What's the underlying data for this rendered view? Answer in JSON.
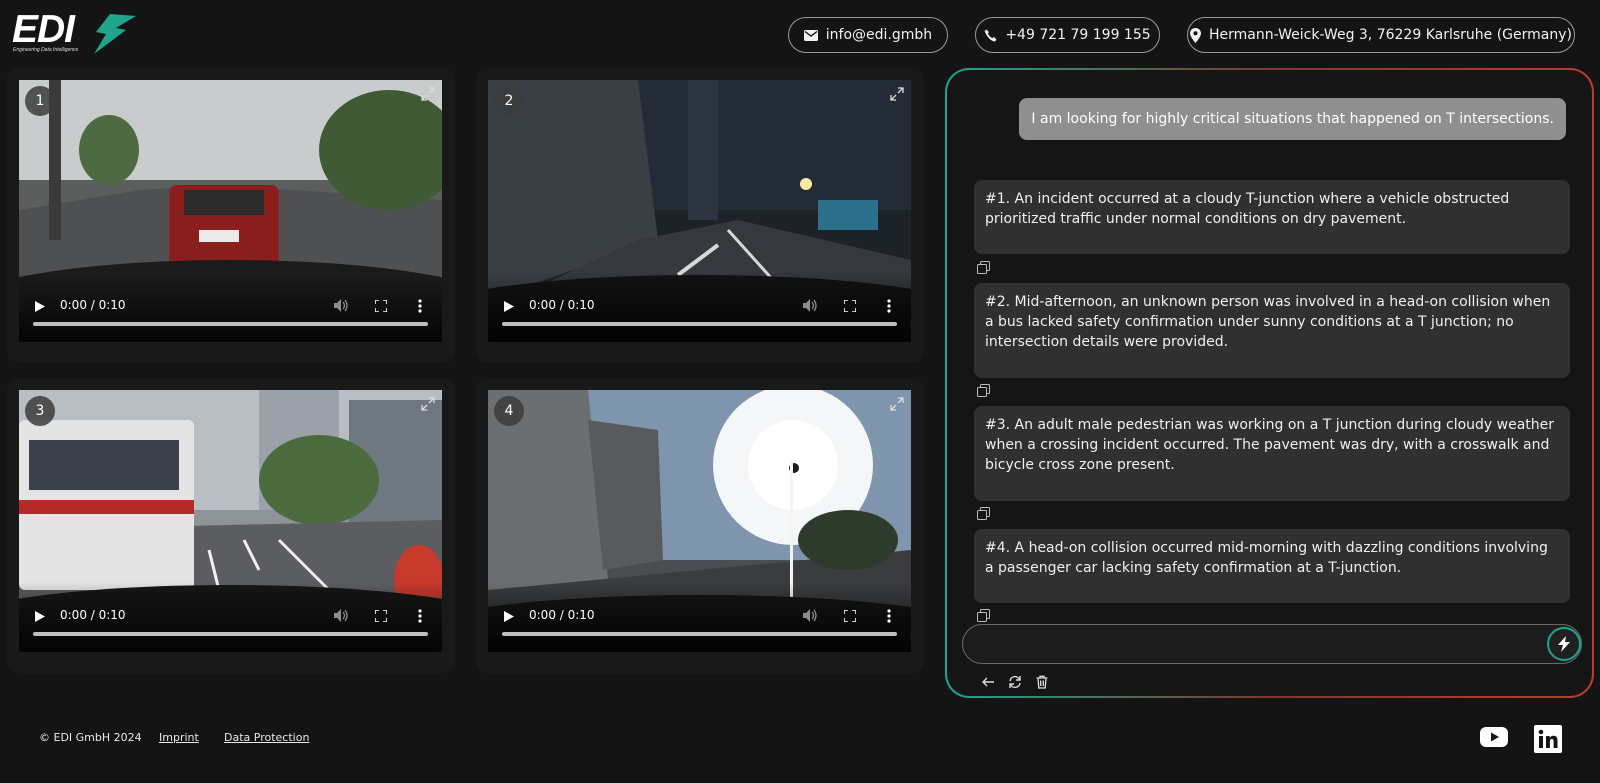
{
  "header": {
    "logo_text": "EDI",
    "logo_tagline": "Engineering Data Intelligence",
    "email": "info@edi.gmbh",
    "phone": "+49 721 79 199 155",
    "address": "Hermann-Weick-Weg 3, 76229 Karlsruhe (Germany)"
  },
  "videos": [
    {
      "number": "1",
      "time": "0:00 / 0:10"
    },
    {
      "number": "2",
      "time": "0:00 / 0:10"
    },
    {
      "number": "3",
      "time": "0:00 / 0:10"
    },
    {
      "number": "4",
      "time": "0:00 / 0:10"
    }
  ],
  "chat": {
    "user_message": "I am looking for highly critical situations that happened on T intersections.",
    "results": [
      "#1. An incident occurred at a cloudy T-junction where a vehicle obstructed prioritized traffic under normal conditions on dry pavement.",
      "#2. Mid-afternoon, an unknown person was involved in a head-on collision when a bus lacked safety confirmation under sunny conditions at a T junction; no intersection details were provided.",
      "#3. An adult male pedestrian was working on a T junction during cloudy weather when a crossing incident occurred. The pavement was dry, with a crosswalk and bicycle cross zone present.",
      "#4. A head-on collision occurred mid-morning with dazzling conditions involving a passenger car lacking safety confirmation at a T-junction."
    ],
    "input_value": "",
    "accent_color": "#1fa58c"
  },
  "footer": {
    "copyright": "© EDI GmbH 2024",
    "imprint": "Imprint",
    "data_protection": "Data Protection"
  },
  "icons": [
    "mail-icon",
    "phone-icon",
    "location-icon",
    "play-icon",
    "volume-icon",
    "fullscreen-icon",
    "more-icon",
    "expand-icon",
    "copy-icon",
    "send-icon",
    "back-icon",
    "refresh-icon",
    "trash-icon",
    "youtube-icon",
    "linkedin-icon"
  ]
}
